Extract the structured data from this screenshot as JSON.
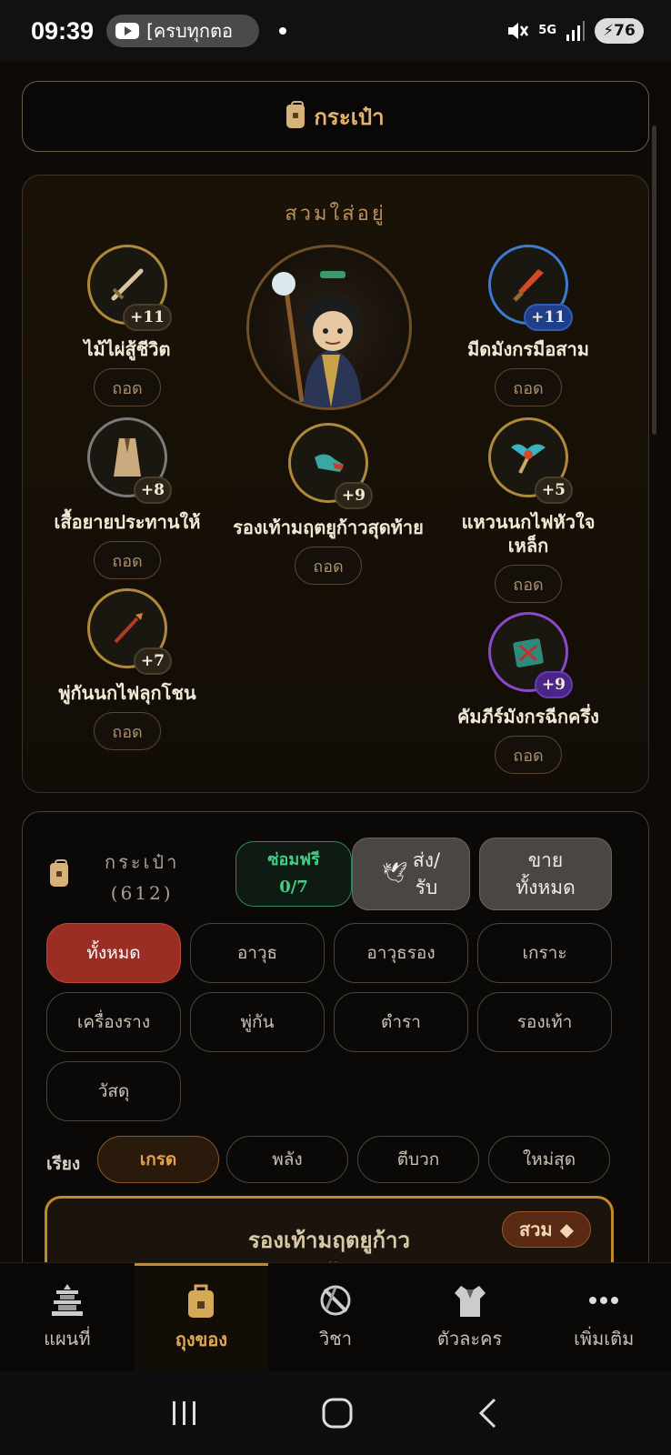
{
  "status": {
    "time": "09:39",
    "notification_text": "[ครบทุกตอ",
    "network": "5G",
    "battery": "76"
  },
  "header": {
    "title": "กระเป๋า"
  },
  "equipped": {
    "heading": "สวมใส่อยู่",
    "slots": [
      {
        "name": "ไม้ไผ่สู้ชีวิต",
        "level": "+11",
        "remove": "ถอด",
        "icon": "sword-icon"
      },
      {
        "name": "มีดมังกรมือสาม",
        "level": "+11",
        "remove": "ถอด",
        "icon": "dagger-icon"
      },
      {
        "name": "เสื้อยายประทานให้",
        "level": "+8",
        "remove": "ถอด",
        "icon": "robe-icon"
      },
      {
        "name": "รองเท้ามฤตยูก้าวสุดท้าย",
        "level": "+9",
        "remove": "ถอด",
        "icon": "boots-icon"
      },
      {
        "name": "แหวนนกไฟหัวใจเหล็ก",
        "level": "+5",
        "remove": "ถอด",
        "icon": "ring-icon"
      },
      {
        "name": "พู่กันนกไฟลุกโชน",
        "level": "+7",
        "remove": "ถอด",
        "icon": "brush-icon"
      },
      {
        "name": "คัมภีร์มังกรฉีกครึ่ง",
        "level": "+9",
        "remove": "ถอด",
        "icon": "scroll-book-icon"
      }
    ]
  },
  "bag": {
    "label": "กระเป๋า",
    "count": "(612)",
    "repair_label": "ซ่อมฟรี",
    "repair_count": "0/7",
    "send_label": "ส่ง/\nรับ",
    "sell_all_label": "ขาย\nทั้งหมด",
    "filters": [
      "ทั้งหมด",
      "อาวุธ",
      "อาวุธรอง",
      "เกราะ",
      "เครื่องราง",
      "พู่กัน",
      "ตำรา",
      "รองเท้า",
      "วัสดุ"
    ],
    "active_filter": "ทั้งหมด",
    "sort_label": "เรียง",
    "sorts": [
      "เกรด",
      "พลัง",
      "ตีบวก",
      "ใหม่สุด"
    ],
    "active_sort": "เกรด",
    "first_item": {
      "title": "รองเท้ามฤตยูก้าว\nสุดท้าย",
      "wear_label": "สวม"
    }
  },
  "nav": [
    {
      "label": "แผนที่",
      "icon": "pagoda-icon"
    },
    {
      "label": "ถุงของ",
      "icon": "bag-icon",
      "active": true
    },
    {
      "label": "วิชา",
      "icon": "crossed-sword-icon"
    },
    {
      "label": "ตัวละคร",
      "icon": "armor-icon"
    },
    {
      "label": "เพิ่มเติม",
      "icon": "more-icon"
    }
  ],
  "colors": {
    "accent": "#e0a850",
    "active_filter": "#9a2d24",
    "repair_green": "#3fcf86"
  }
}
